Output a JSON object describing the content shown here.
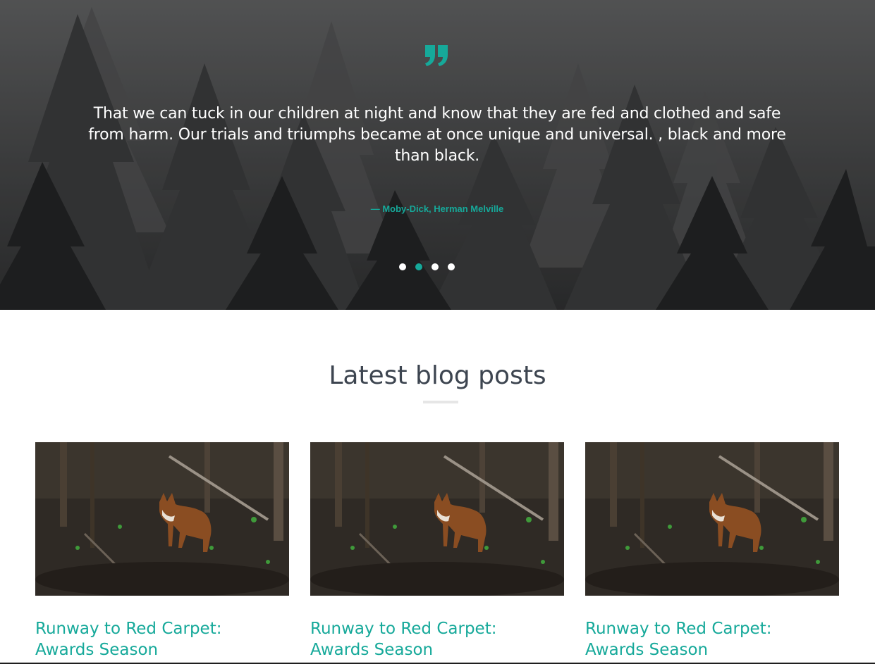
{
  "colors": {
    "accent": "#16a99a",
    "heading": "#3d4550",
    "hero_text": "#ffffff"
  },
  "testimonial": {
    "quote_icon": "quote-right-icon",
    "text": "That we can tuck in our children at night and know that they are fed and clothed and safe from harm. Our trials and triumphs became at once unique and universal. , black and more than black.",
    "author": "— Moby-Dick, Herman Melville",
    "slider_dots": [
      {
        "active": false
      },
      {
        "active": true
      },
      {
        "active": false
      },
      {
        "active": false
      }
    ]
  },
  "blog": {
    "heading": "Latest blog posts",
    "posts": [
      {
        "title": "Runway to Red Carpet: Awards Season",
        "image": "fox-in-forest-photo"
      },
      {
        "title": "Runway to Red Carpet: Awards Season",
        "image": "fox-in-forest-photo"
      },
      {
        "title": "Runway to Red Carpet: Awards Season",
        "image": "fox-in-forest-photo"
      }
    ]
  }
}
